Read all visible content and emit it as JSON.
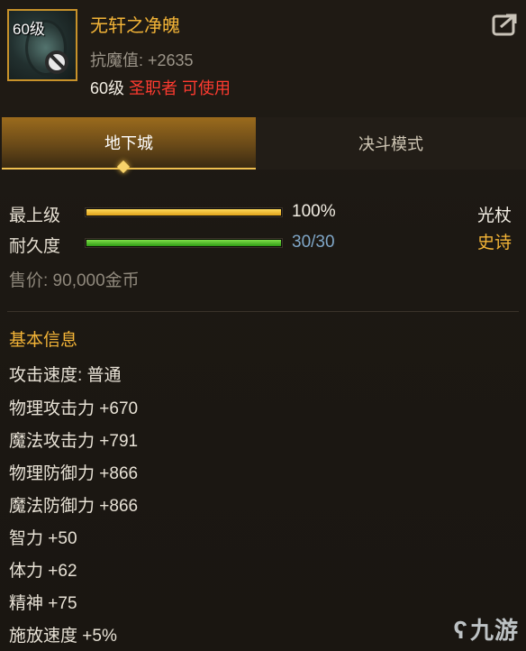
{
  "item": {
    "level_tag": "60级",
    "name": "无轩之净魄",
    "anti_magic": "抗魔值: +2635",
    "req_level": "60级",
    "req_class": "圣职者 可使用"
  },
  "tabs": [
    {
      "label": "地下城",
      "active": true
    },
    {
      "label": "决斗模式",
      "active": false
    }
  ],
  "stats": {
    "grade_label": "最上级",
    "grade_value": "100%",
    "grade_percent": 100,
    "durability_label": "耐久度",
    "durability_value": "30/30",
    "durability_fraction": 1.0,
    "weapon_type": "光杖",
    "rarity": "史诗",
    "price": "售价: 90,000金币"
  },
  "basic_info": {
    "title": "基本信息",
    "lines": [
      "攻击速度: 普通",
      "物理攻击力 +670",
      "魔法攻击力 +791",
      "物理防御力 +866",
      "魔法防御力 +866",
      "智力 +50",
      "体力 +62",
      "精神 +75",
      "施放速度 +5%"
    ]
  },
  "watermark": "九游",
  "colors": {
    "name_gold": "#f3b437",
    "requirement_red": "#ff3b30",
    "durability_blue": "#7fa6c7"
  }
}
